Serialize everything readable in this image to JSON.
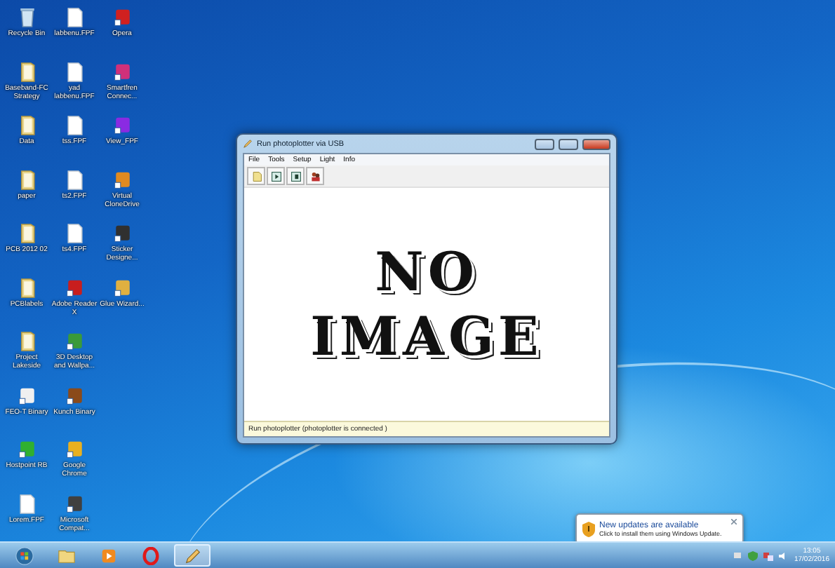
{
  "desktop": {
    "rows": [
      [
        {
          "label": "Recycle Bin",
          "kind": "recycle"
        },
        {
          "label": "labbenu.FPF",
          "kind": "file"
        },
        {
          "label": "Opera",
          "kind": "app",
          "color": "#d02020"
        }
      ],
      [
        {
          "label": "Baseband-FC Strategy",
          "kind": "folder"
        },
        {
          "label": "yad labbenu.FPF",
          "kind": "file"
        },
        {
          "label": "Smartfren Connec...",
          "kind": "app",
          "color": "#d0307a"
        }
      ],
      [
        {
          "label": "Data",
          "kind": "folder"
        },
        {
          "label": "tss.FPF",
          "kind": "file"
        },
        {
          "label": "View_FPF",
          "kind": "app",
          "color": "#8a2be2"
        }
      ],
      [
        {
          "label": "paper",
          "kind": "folder"
        },
        {
          "label": "ts2.FPF",
          "kind": "file"
        },
        {
          "label": "Virtual CloneDrive",
          "kind": "app",
          "color": "#e08a20"
        }
      ],
      [
        {
          "label": "PCB 2012 02",
          "kind": "folder"
        },
        {
          "label": "ts4.FPF",
          "kind": "file"
        },
        {
          "label": "Sticker Designe...",
          "kind": "app",
          "color": "#303030"
        }
      ],
      [
        {
          "label": "PCBlabels",
          "kind": "folder"
        },
        {
          "label": "Adobe Reader X",
          "kind": "app",
          "color": "#c81e1e"
        },
        {
          "label": "Glue Wizard...",
          "kind": "app",
          "color": "#e0b040"
        }
      ],
      [
        {
          "label": "Project Lakeside",
          "kind": "folder"
        },
        {
          "label": "3D Desktop and Wallpa...",
          "kind": "app",
          "color": "#3a9a3a"
        }
      ],
      [
        {
          "label": "FEO-T Binary",
          "kind": "app",
          "color": "#f0f0f0"
        },
        {
          "label": "Kunch Binary",
          "kind": "app",
          "color": "#8a4a1a"
        }
      ],
      [
        {
          "label": "Hostpoint RB",
          "kind": "app",
          "color": "#30b030"
        },
        {
          "label": "Google Chrome",
          "kind": "app",
          "color": "#e8b020"
        }
      ],
      [
        {
          "label": "Lorem.FPF",
          "kind": "file"
        },
        {
          "label": "Microsoft Compat...",
          "kind": "app",
          "color": "#404040"
        }
      ]
    ]
  },
  "window": {
    "title": "Run photoplotter via USB",
    "menu": [
      "File",
      "Tools",
      "Setup",
      "Light",
      "Info"
    ],
    "toolbar": [
      {
        "kind": "new"
      },
      {
        "kind": "play"
      },
      {
        "kind": "step"
      },
      {
        "kind": "people"
      }
    ],
    "content_lines": [
      "NO",
      "IMAGE"
    ],
    "status_bar": "Run photoplotter (photoplotter is connected )"
  },
  "notification": {
    "title": "New updates are available",
    "body": "Click to install them using Windows Update."
  },
  "taskbar": {
    "items": [
      {
        "kind": "start",
        "selected": false
      },
      {
        "kind": "explorer",
        "selected": false
      },
      {
        "kind": "media",
        "selected": false
      },
      {
        "kind": "opera",
        "selected": false
      },
      {
        "kind": "pencil",
        "selected": true
      }
    ],
    "clock": {
      "time": "13:05",
      "date": "17/02/2016"
    }
  }
}
